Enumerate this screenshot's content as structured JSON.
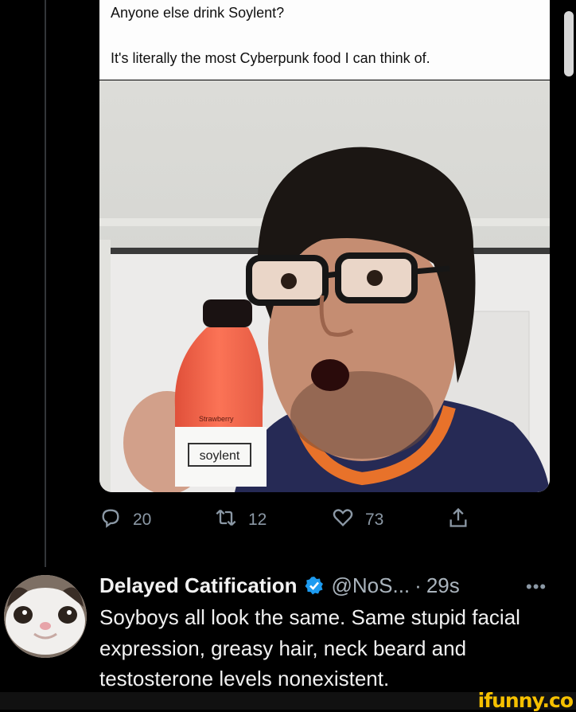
{
  "quoted_tweet": {
    "line1": "Anyone else drink Soylent?",
    "line2": "It's literally the most Cyberpunk food I can think of."
  },
  "photo": {
    "bottle_brand": "soylent",
    "bottle_flavor": "Strawberry"
  },
  "actions": {
    "reply_count": "20",
    "retweet_count": "12",
    "like_count": "73"
  },
  "reply": {
    "display_name": "Delayed Catification",
    "handle": "@NoS...",
    "separator": "·",
    "time": "29s",
    "text": "Soyboys all look the same. Same stupid facial expression, greasy hair, neck beard and testosterone levels nonexistent."
  },
  "watermark": "ifunny.co",
  "colors": {
    "background": "#000000",
    "muted": "#8b98a5",
    "verified": "#1d9bf0",
    "watermark": "#f6c000"
  }
}
